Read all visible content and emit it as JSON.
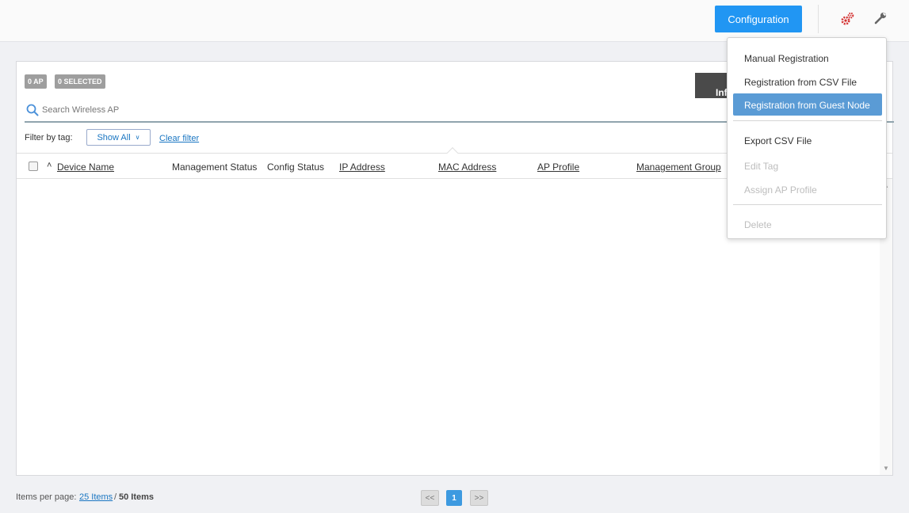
{
  "header": {
    "config_button": "Configuration",
    "icons": [
      "gear-icon",
      "wrench-icon"
    ],
    "accent": "#2196f3"
  },
  "panel": {
    "badges": {
      "ap": "0 AP",
      "selected": "0 SELECTED"
    },
    "dark_tab_label": "Inf",
    "search": {
      "placeholder": "Search Wireless AP",
      "value": ""
    },
    "filter": {
      "label": "Filter by tag:",
      "show_all": "Show All",
      "clear": "Clear filter"
    },
    "columns": [
      "Device Name",
      "Management Status",
      "Config Status",
      "IP Address",
      "MAC Address",
      "AP Profile",
      "Management Group"
    ],
    "rows": []
  },
  "footer": {
    "items_per_page_label": "Items per page:",
    "per_page": "25 Items",
    "separator": "/",
    "total": "50 Items",
    "pagination": {
      "first": "<<",
      "current": "1",
      "last": ">>"
    }
  },
  "menu": {
    "items": [
      {
        "label": "Manual Registration",
        "state": "enabled"
      },
      {
        "label": "Registration from CSV File",
        "state": "enabled"
      },
      {
        "label": "Registration from Guest Node",
        "state": "highlighted"
      },
      {
        "label": "Export CSV File",
        "state": "enabled"
      },
      {
        "label": "Edit Tag",
        "state": "disabled"
      },
      {
        "label": "Assign AP Profile",
        "state": "disabled"
      },
      {
        "label": "Delete",
        "state": "disabled"
      }
    ],
    "highlight_color": "#5a9bd5"
  }
}
